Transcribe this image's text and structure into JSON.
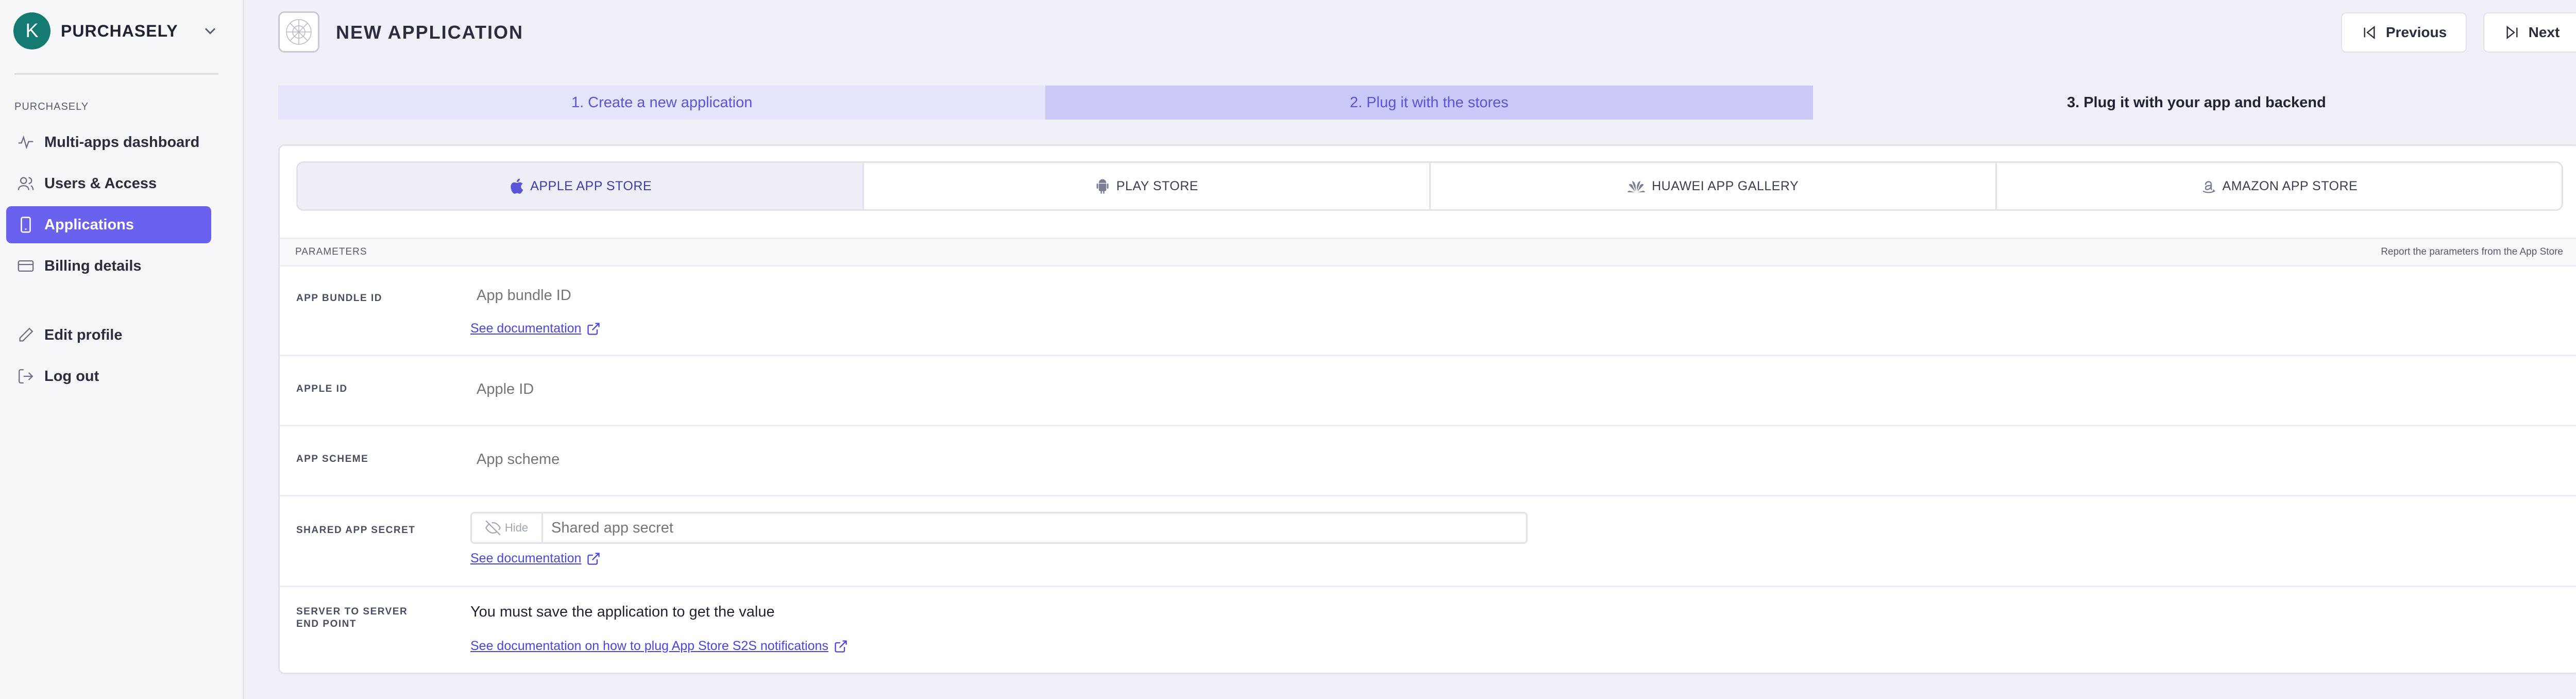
{
  "sidebar": {
    "org_initial": "K",
    "org_name": "PURCHASELY",
    "section_label": "PURCHASELY",
    "items": [
      {
        "label": "Multi-apps dashboard",
        "icon": "activity-icon"
      },
      {
        "label": "Users & Access",
        "icon": "users-icon"
      },
      {
        "label": "Applications",
        "icon": "phone-icon",
        "active": true
      },
      {
        "label": "Billing details",
        "icon": "credit-card-icon"
      },
      {
        "label": "Edit profile",
        "icon": "pencil-icon"
      },
      {
        "label": "Log out",
        "icon": "logout-icon"
      }
    ]
  },
  "header": {
    "title": "NEW APPLICATION",
    "previous_label": "Previous",
    "next_label": "Next"
  },
  "steps": [
    {
      "label": "1. Create a new application",
      "state": "done"
    },
    {
      "label": "2. Plug it with the stores",
      "state": "current"
    },
    {
      "label": "3. Plug it with your app and backend",
      "state": "upcoming"
    }
  ],
  "stores": [
    {
      "label": "APPLE APP STORE",
      "icon": "apple-icon",
      "active": true
    },
    {
      "label": "PLAY STORE",
      "icon": "android-icon"
    },
    {
      "label": "HUAWEI APP GALLERY",
      "icon": "huawei-icon"
    },
    {
      "label": "AMAZON APP STORE",
      "icon": "amazon-icon"
    }
  ],
  "parameters": {
    "section_label": "PARAMETERS",
    "hint": "Report the parameters from the App Store",
    "bundle_id": {
      "label": "APP BUNDLE ID",
      "placeholder": "App bundle ID",
      "doc_link": "See documentation"
    },
    "apple_id": {
      "label": "APPLE ID",
      "placeholder": "Apple ID"
    },
    "app_scheme": {
      "label": "APP SCHEME",
      "placeholder": "App scheme"
    },
    "shared_secret": {
      "label": "SHARED APP SECRET",
      "hide_label": "Hide",
      "placeholder": "Shared app secret",
      "doc_link": "See documentation"
    },
    "s2s": {
      "label": "SERVER TO SERVER END POINT",
      "text": "You must save the application to get the value",
      "doc_link": "See documentation on how to plug App Store S2S notifications"
    }
  },
  "colors": {
    "accent": "#6a61ee",
    "link": "#4a47d8",
    "avatar": "#147a72"
  }
}
